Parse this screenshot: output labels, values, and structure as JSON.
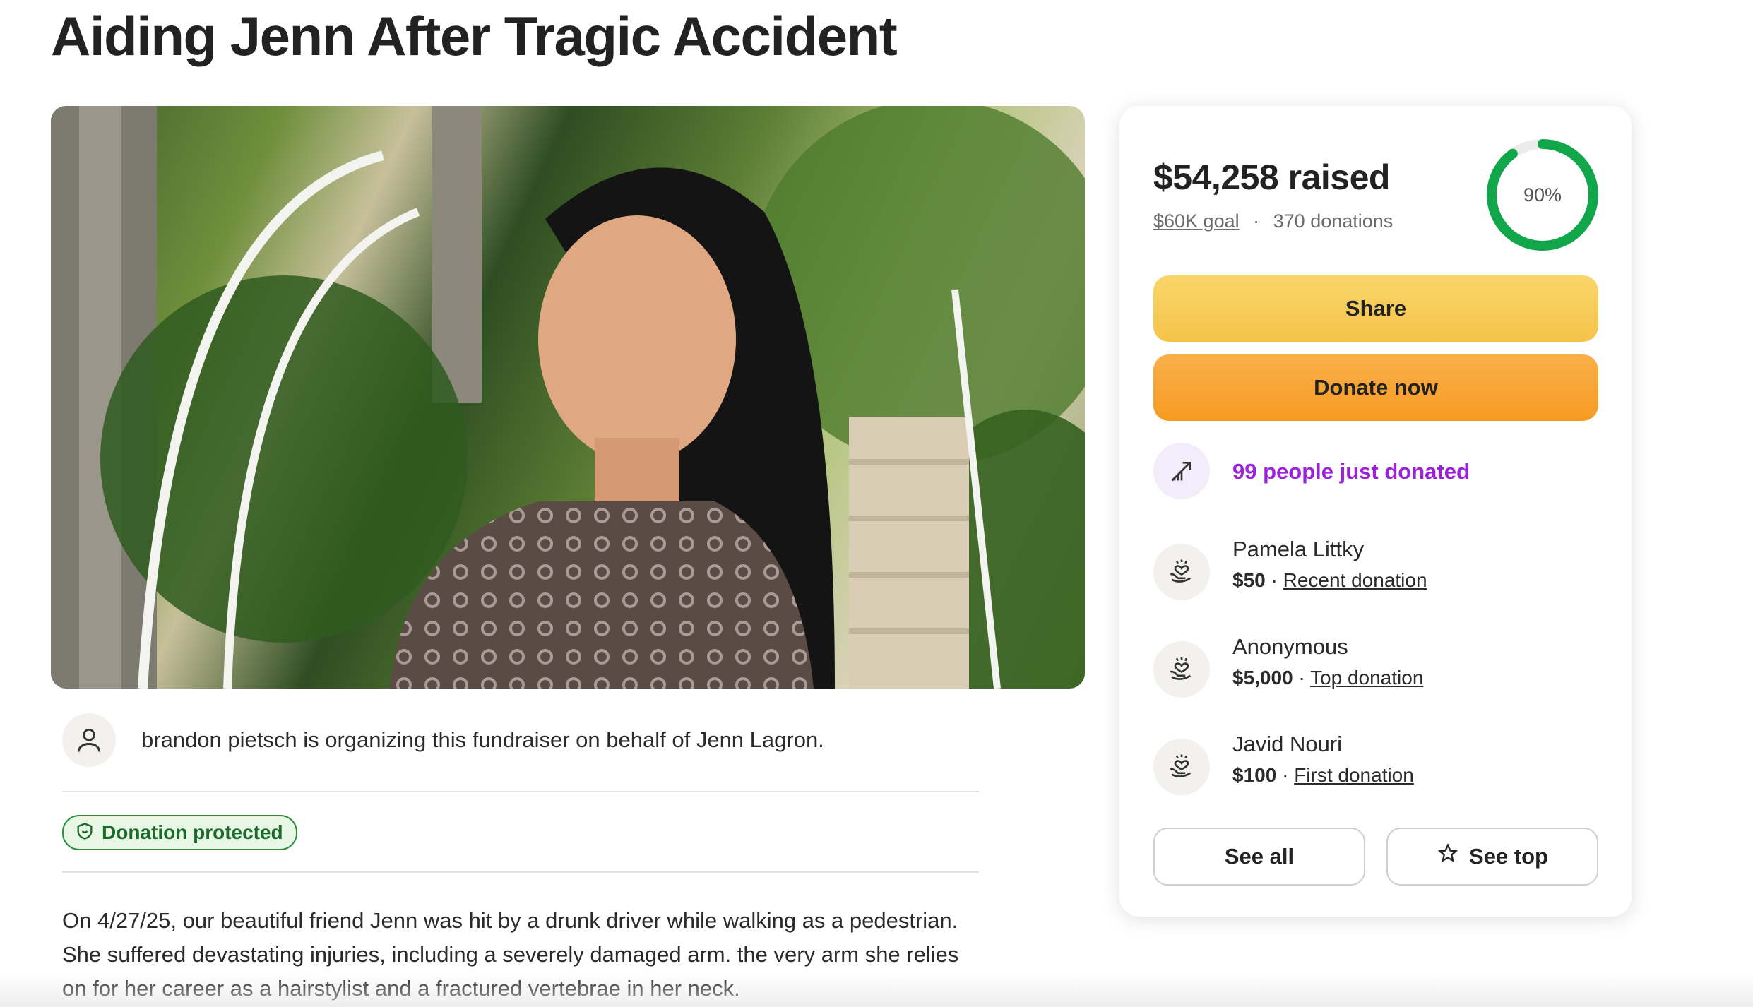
{
  "page": {
    "title": "Aiding Jenn After Tragic Accident"
  },
  "organizer": {
    "text": "brandon pietsch is organizing this fundraiser on behalf of Jenn Lagron.",
    "icon": "user-icon"
  },
  "badge": {
    "label": "Donation protected",
    "icon": "shield-icon",
    "color": "#1a6b2a"
  },
  "story": {
    "text": "On 4/27/25, our beautiful friend Jenn was hit by a drunk driver while walking as a pedestrian. She suffered devastating injuries, including a severely damaged arm. the very arm she relies on for her career as a hairstylist and a fractured vertebrae in her neck."
  },
  "card": {
    "raised": "$54,258 raised",
    "goal": "$60K goal",
    "separator": "·",
    "donations": "370 donations",
    "progress_label": "90%",
    "progress": 0.9,
    "share_label": "Share",
    "donate_label": "Donate now",
    "trend_text": "99 people just donated",
    "trend_icon": "trending-up-icon",
    "donors": [
      {
        "name": "Pamela Littky",
        "amount": "$50",
        "sep": " · ",
        "tag": "Recent donation",
        "icon": "heart-hands-icon"
      },
      {
        "name": "Anonymous",
        "amount": "$5,000",
        "sep": " · ",
        "tag": "Top donation",
        "icon": "heart-hands-icon"
      },
      {
        "name": "Javid Nouri",
        "amount": "$100",
        "sep": " · ",
        "tag": "First donation",
        "icon": "heart-hands-icon"
      }
    ],
    "see_all_label": "See all",
    "see_top_label": "See top",
    "see_top_icon": "star-icon"
  },
  "colors": {
    "share": "#f5c34a",
    "donate": "#f79a23",
    "progress": "#11a64a",
    "trend": "#9b22d8"
  }
}
